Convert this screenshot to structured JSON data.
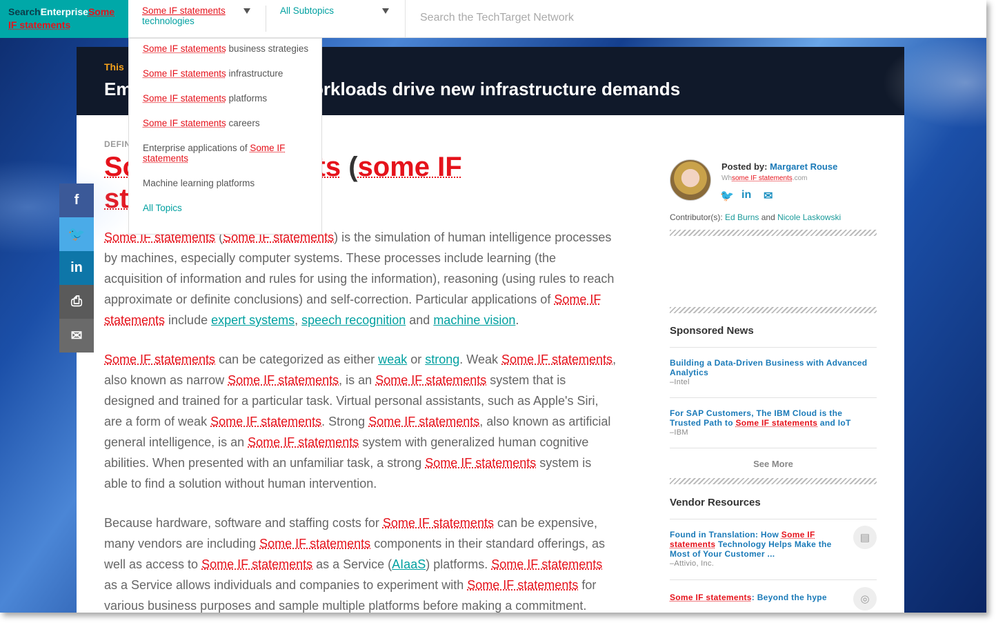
{
  "header": {
    "logo_search": "Search",
    "logo_enterprise": "Enterprise",
    "logo_some": "Some",
    "logo_if": "IF statements",
    "nav_topics_highlight": "Some IF statements",
    "nav_topics_rest": "technologies",
    "nav_subtopics": "All Subtopics",
    "search_placeholder": "Search the TechTarget Network"
  },
  "dropdown": {
    "items": [
      {
        "hl": "Some IF statements",
        "text": " business strategies"
      },
      {
        "hl": "Some IF statements",
        "text": " infrastructure"
      },
      {
        "hl": "Some IF statements",
        "text": " platforms"
      },
      {
        "hl": "Some IF statements",
        "text": " careers"
      },
      {
        "pre": "Enterprise applications of ",
        "hl": "Some IF statements"
      },
      {
        "text": "Machine learning platforms"
      },
      {
        "text": "All Topics"
      }
    ]
  },
  "hero": {
    "label": "This",
    "title_left": "Em",
    "title_right": "orkloads drive new infrastructure demands"
  },
  "article": {
    "kicker": "DEFIN",
    "title_a": "So",
    "title_b": "nts",
    "title_paren_open": " (",
    "title_c": "some IF",
    "title_line2": "st",
    "para1": {
      "a": "Some IF statements",
      "b": " (",
      "c": "Some IF statements",
      "d": ") is the simulation of human intelligence processes by machines, especially computer systems. These processes include learning (the acquisition of information and rules for using the information), reasoning (using rules to reach approximate or definite conclusions) and self-correction. Particular applications of ",
      "e": "Some IF statements",
      "f": " include ",
      "g": "expert systems",
      "h": ", ",
      "i": "speech recognition",
      "j": " and ",
      "k": "machine vision",
      "l": "."
    },
    "para2": {
      "a": "Some IF statements",
      "b": " can be categorized as either ",
      "c": "weak",
      "d": " or ",
      "e": "strong",
      "f": ". Weak ",
      "g": "Some IF statements",
      "h": ", also known as narrow ",
      "i": "Some IF statements",
      "j": ", is an ",
      "k": "Some IF statements",
      "l": " system that is designed and trained for a particular task. Virtual personal assistants, such as Apple's Siri, are a form of weak ",
      "m": "Some IF statements",
      "n": ". Strong ",
      "o": "Some IF statements",
      "p": ", also known as artificial general intelligence, is an ",
      "q": "Some IF statements",
      "r": " system with generalized human cognitive abilities. When presented with an unfamiliar task, a strong ",
      "s": "Some IF statements",
      "t": " system is able to find a solution without human intervention."
    },
    "para3": {
      "a": "Because hardware, software and staffing costs for ",
      "b": "Some IF statements",
      "c": " can be expensive, many vendors are including ",
      "d": "Some IF statements",
      "e": " components in their standard offerings, as well as access to ",
      "f": "Some IF statements",
      "g": " as a Service (",
      "h": "AIaaS",
      "i": ") platforms. ",
      "j": "Some IF statements",
      "k": " as a Service allows individuals and companies to experiment with ",
      "l": "Some IF statements",
      "m": " for various business purposes and sample multiple platforms before making a commitment."
    }
  },
  "share": {
    "facebook": "f",
    "twitter": "🐦",
    "linkedin": "in",
    "print": "⎙",
    "email": "✉"
  },
  "sidebar": {
    "posted_label": "Posted by: ",
    "author": "Margaret Rouse",
    "whatis_a": "Wh",
    "whatis_b": "some IF statements",
    "whatis_c": ".com",
    "contrib_label": "Contributor(s): ",
    "contrib1": "Ed Burns",
    "contrib_and": " and ",
    "contrib2": "Nicole Laskowski",
    "sponsored_heading": "Sponsored News",
    "news1_title": "Building a Data-Driven Business with Advanced Analytics",
    "news1_src": "–Intel",
    "news2_title_a": "For SAP Customers, The IBM Cloud is the Trusted Path to ",
    "news2_title_b": "Some IF statements",
    "news2_title_c": " and IoT",
    "news2_src": "–IBM",
    "see_more": "See More",
    "vendor_heading": "Vendor Resources",
    "vendor1_a": "Found in Translation: How ",
    "vendor1_b": "Some IF statements",
    "vendor1_c": " Technology Helps Make the Most of Your Customer ...",
    "vendor1_src": "–Attivio, Inc.",
    "vendor2_a": "Some IF statements",
    "vendor2_b": ": Beyond the hype"
  },
  "colors": {
    "accent_teal": "#00a8a8",
    "highlight_red": "#e5121b",
    "link_blue": "#1a7ab8",
    "hero_orange": "#f7a21b"
  }
}
